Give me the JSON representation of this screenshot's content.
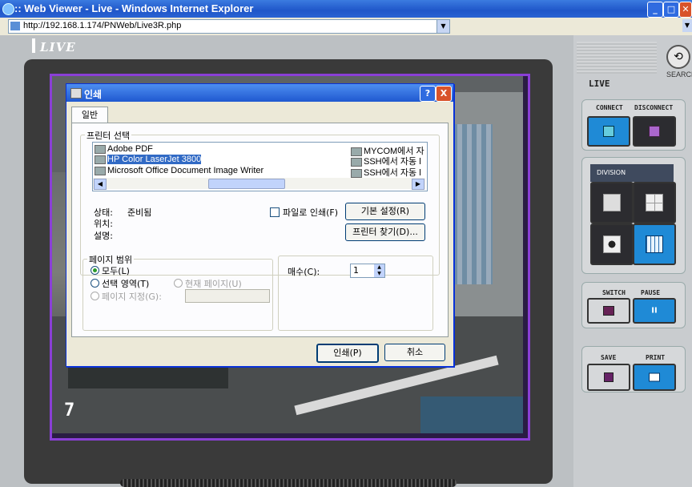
{
  "window": {
    "title": ":: Web Viewer - Live - Windows Internet Explorer",
    "controls": [
      "minimize-icon",
      "maximize-icon",
      "close-icon"
    ]
  },
  "address_bar": {
    "url": "http://192.168.1.174/PNWeb/Live3R.php"
  },
  "app": {
    "live_label": "LIVE",
    "camera_number": "7",
    "side_live_label": "LIVE",
    "search_label": "SEARCH",
    "connect_label": "CONNECT",
    "disconnect_label": "DISCONNECT",
    "division_label": "DIVISION",
    "switch_label": "SWITCH",
    "pause_label": "PAUSE",
    "save_label": "SAVE",
    "print_label": "PRINT"
  },
  "dialog": {
    "title": "인쇄",
    "help": "?",
    "close": "X",
    "tab": "일반",
    "printer_group": "프린터 선택",
    "printers_left": [
      "Adobe PDF",
      "HP Color LaserJet 3800",
      "Microsoft Office Document Image Writer"
    ],
    "printers_right": [
      "MYCOM에서 자",
      "SSH에서 자동 l",
      "SSH에서 자동 l"
    ],
    "selected_printer": "HP Color LaserJet 3800",
    "status_label": "상태:",
    "status_value": "준비됨",
    "location_label": "위치:",
    "comment_label": "설명:",
    "print_to_file": "파일로 인쇄(F)",
    "preferences_button": "기본 설정(R)",
    "find_printer_button": "프린터 찾기(D)...",
    "page_range_group": "페이지 범위",
    "range_all": "모두(L)",
    "range_selection": "선택 영역(T)",
    "range_current": "현재 페이지(U)",
    "range_pages": "페이지 지정(G):",
    "copies_label": "매수(C):",
    "copies_value": "1",
    "print_button": "인쇄(P)",
    "cancel_button": "취소"
  },
  "colors": {
    "titlebar": "#1f56c9",
    "accent_blue": "#1f8ad6",
    "frame_purple": "#8a3fd6",
    "selection": "#316ac5"
  }
}
